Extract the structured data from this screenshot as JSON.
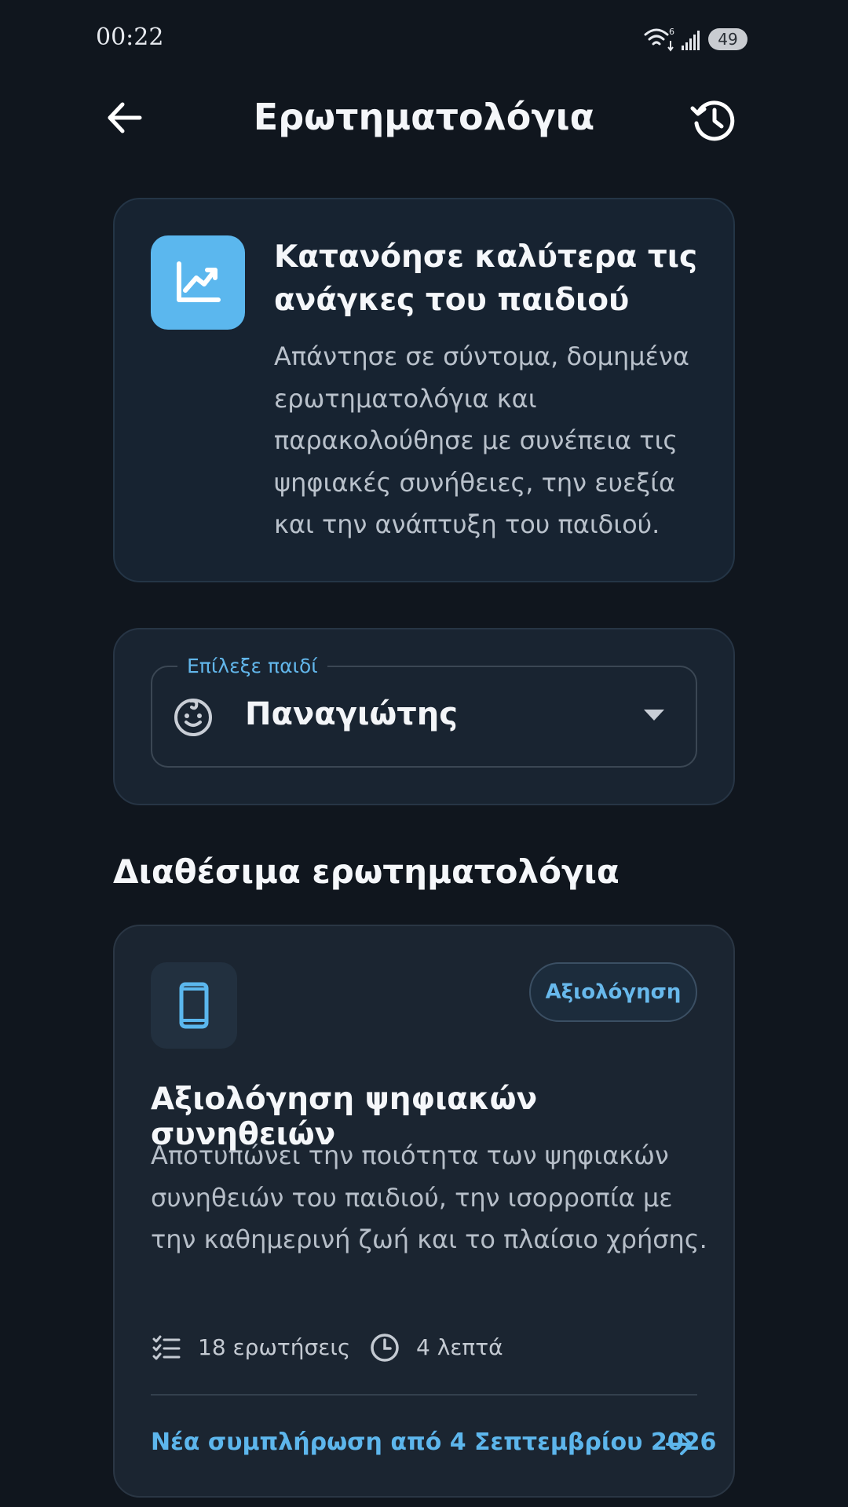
{
  "status_bar": {
    "time": "00:22",
    "battery_level": "49",
    "icons": [
      "wifi-6-icon",
      "signal-icon",
      "battery-icon"
    ]
  },
  "app_bar": {
    "title": "Ερωτηματολόγια",
    "back_icon": "arrow-back-icon",
    "history_icon": "history-icon"
  },
  "intro": {
    "icon": "trending-up-chart-icon",
    "title": "Κατανόησε καλύτερα τις ανάγκες του παιδιού",
    "text": "Απάντησε σε σύντομα, δομημένα ερωτηματολόγια και παρακολούθησε με συνέπεια τις ψηφιακές συνήθειες, την ευεξία και την ανάπτυξη του παιδιού."
  },
  "child_selector": {
    "label": "Επίλεξε παιδί",
    "selected": "Παναγιώτης",
    "icon": "child-face-icon"
  },
  "section": {
    "title": "Διαθέσιμα ερωτηματολόγια"
  },
  "questionnaires": [
    {
      "icon": "smartphone-icon",
      "badge": "Αξιολόγηση",
      "title": "Αξιολόγηση ψηφιακών συνηθειών",
      "description": "Αποτυπώνει την ποιότητα των ψηφιακών συνηθειών του παιδιού, την ισορροπία με την καθημερινή ζωή και το πλαίσιο χρήσης.",
      "questions": "18 ερωτήσεις",
      "duration": "4 λεπτά",
      "next_completion": "Νέα συμπλήρωση από 4 Σεπτεμβρίου 2026"
    }
  ],
  "colors": {
    "background": "#10161e",
    "accent": "#5bb7ee",
    "card": "#1b2531"
  }
}
